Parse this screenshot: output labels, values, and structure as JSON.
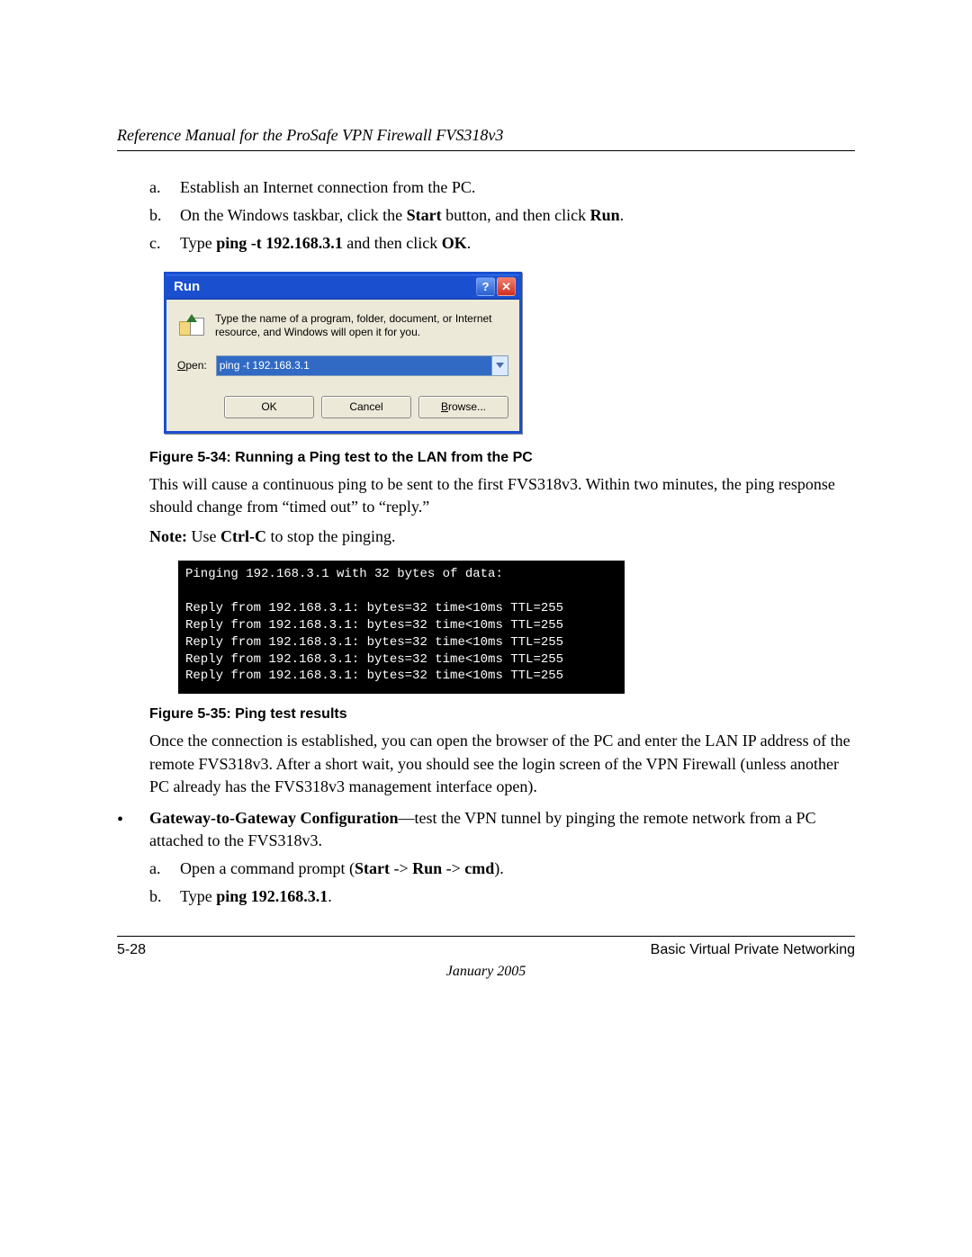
{
  "header": {
    "title": "Reference Manual for the ProSafe VPN Firewall FVS318v3"
  },
  "steps": {
    "a": {
      "marker": "a.",
      "text": "Establish an Internet connection from the PC."
    },
    "b": {
      "marker": "b.",
      "pre": "On the Windows taskbar, click the ",
      "bold1": "Start",
      "mid": " button, and then click ",
      "bold2": "Run",
      "post": "."
    },
    "c": {
      "marker": "c.",
      "pre": "Type  ",
      "cmd": "ping -t 192.168.3.1",
      "mid": "  and then click ",
      "ok": "OK",
      "post": "."
    }
  },
  "run_dialog": {
    "title": "Run",
    "help_symbol": "?",
    "close_symbol": "✕",
    "description": "Type the name of a program, folder, document, or Internet resource, and Windows will open it for you.",
    "open_label_u": "O",
    "open_label_rest": "pen:",
    "input_value": "ping -t 192.168.3.1",
    "buttons": {
      "ok": "OK",
      "cancel": "Cancel",
      "browse_u": "B",
      "browse_rest": "rowse..."
    }
  },
  "fig34": "Figure 5-34:  Running a Ping test to the LAN from the PC",
  "para_after_fig34": "This will cause a continuous ping to be sent to the first FVS318v3. Within two minutes, the ping response should change from “timed out” to “reply.”",
  "note": {
    "label": "Note:",
    "pre": " Use ",
    "cmd": "Ctrl-C",
    "post": " to stop the pinging."
  },
  "terminal_lines": [
    "Pinging 192.168.3.1 with 32 bytes of data:",
    "",
    "Reply from 192.168.3.1: bytes=32 time<10ms TTL=255",
    "Reply from 192.168.3.1: bytes=32 time<10ms TTL=255",
    "Reply from 192.168.3.1: bytes=32 time<10ms TTL=255",
    "Reply from 192.168.3.1: bytes=32 time<10ms TTL=255",
    "Reply from 192.168.3.1: bytes=32 time<10ms TTL=255"
  ],
  "fig35": "Figure 5-35:  Ping test results",
  "para_after_fig35": "Once the connection is established, you can open the browser of the PC and enter the LAN IP address of the remote FVS318v3. After a short wait, you should see the login screen of the VPN Firewall (unless another PC already has the FVS318v3 management interface open).",
  "gateway_bullet": {
    "dot": "•",
    "bold": "Gateway-to-Gateway Configuration",
    "rest": "—test the VPN tunnel by pinging the remote network from a PC attached to the FVS318v3."
  },
  "gw_steps": {
    "a": {
      "marker": "a.",
      "pre": "Open a command prompt (",
      "b1": "Start",
      "a1": " -> ",
      "b2": "Run",
      "a2": " -> ",
      "b3": "cmd",
      "post": ")."
    },
    "b": {
      "marker": "b.",
      "pre": "Type ",
      "cmd": "ping 192.168.3.1",
      "post": "."
    }
  },
  "footer": {
    "left": "5-28",
    "right": "Basic Virtual Private Networking",
    "date": "January 2005"
  }
}
